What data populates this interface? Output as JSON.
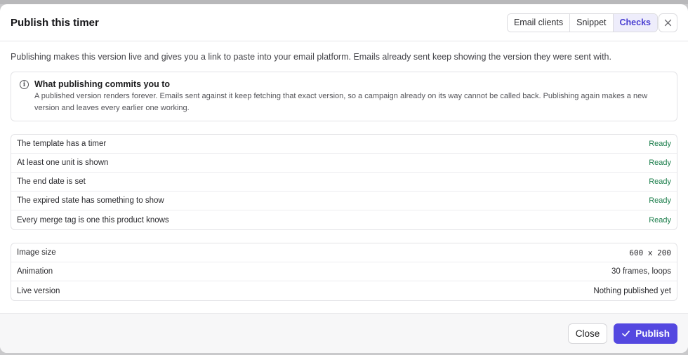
{
  "dialog": {
    "title": "Publish this timer",
    "tabs": [
      {
        "label": "Email clients",
        "active": false
      },
      {
        "label": "Snippet",
        "active": false
      },
      {
        "label": "Checks",
        "active": true
      }
    ],
    "close_icon": "x-icon"
  },
  "intro": "Publishing makes this version live and gives you a link to paste into your email platform. Emails already sent keep showing the version they were sent with.",
  "callout": {
    "icon": "info-icon",
    "title": "What publishing commits you to",
    "text": "A published version renders forever. Emails sent against it keep fetching that exact version, so a campaign already on its way cannot be called back. Publishing again makes a new version and leaves every earlier one working."
  },
  "checks": [
    {
      "label": "The template has a timer",
      "status": "Ready"
    },
    {
      "label": "At least one unit is shown",
      "status": "Ready"
    },
    {
      "label": "The end date is set",
      "status": "Ready"
    },
    {
      "label": "The expired state has something to show",
      "status": "Ready"
    },
    {
      "label": "Every merge tag is one this product knows",
      "status": "Ready"
    }
  ],
  "details": [
    {
      "label": "Image size",
      "value": "600 x 200"
    },
    {
      "label": "Animation",
      "value": "30 frames, loops"
    },
    {
      "label": "Live version",
      "value": "Nothing published yet"
    }
  ],
  "footer": {
    "close_label": "Close",
    "publish_label": "Publish",
    "publish_icon": "check-icon"
  },
  "colors": {
    "accent": "#5448e0",
    "ready": "#1a7d4a"
  }
}
